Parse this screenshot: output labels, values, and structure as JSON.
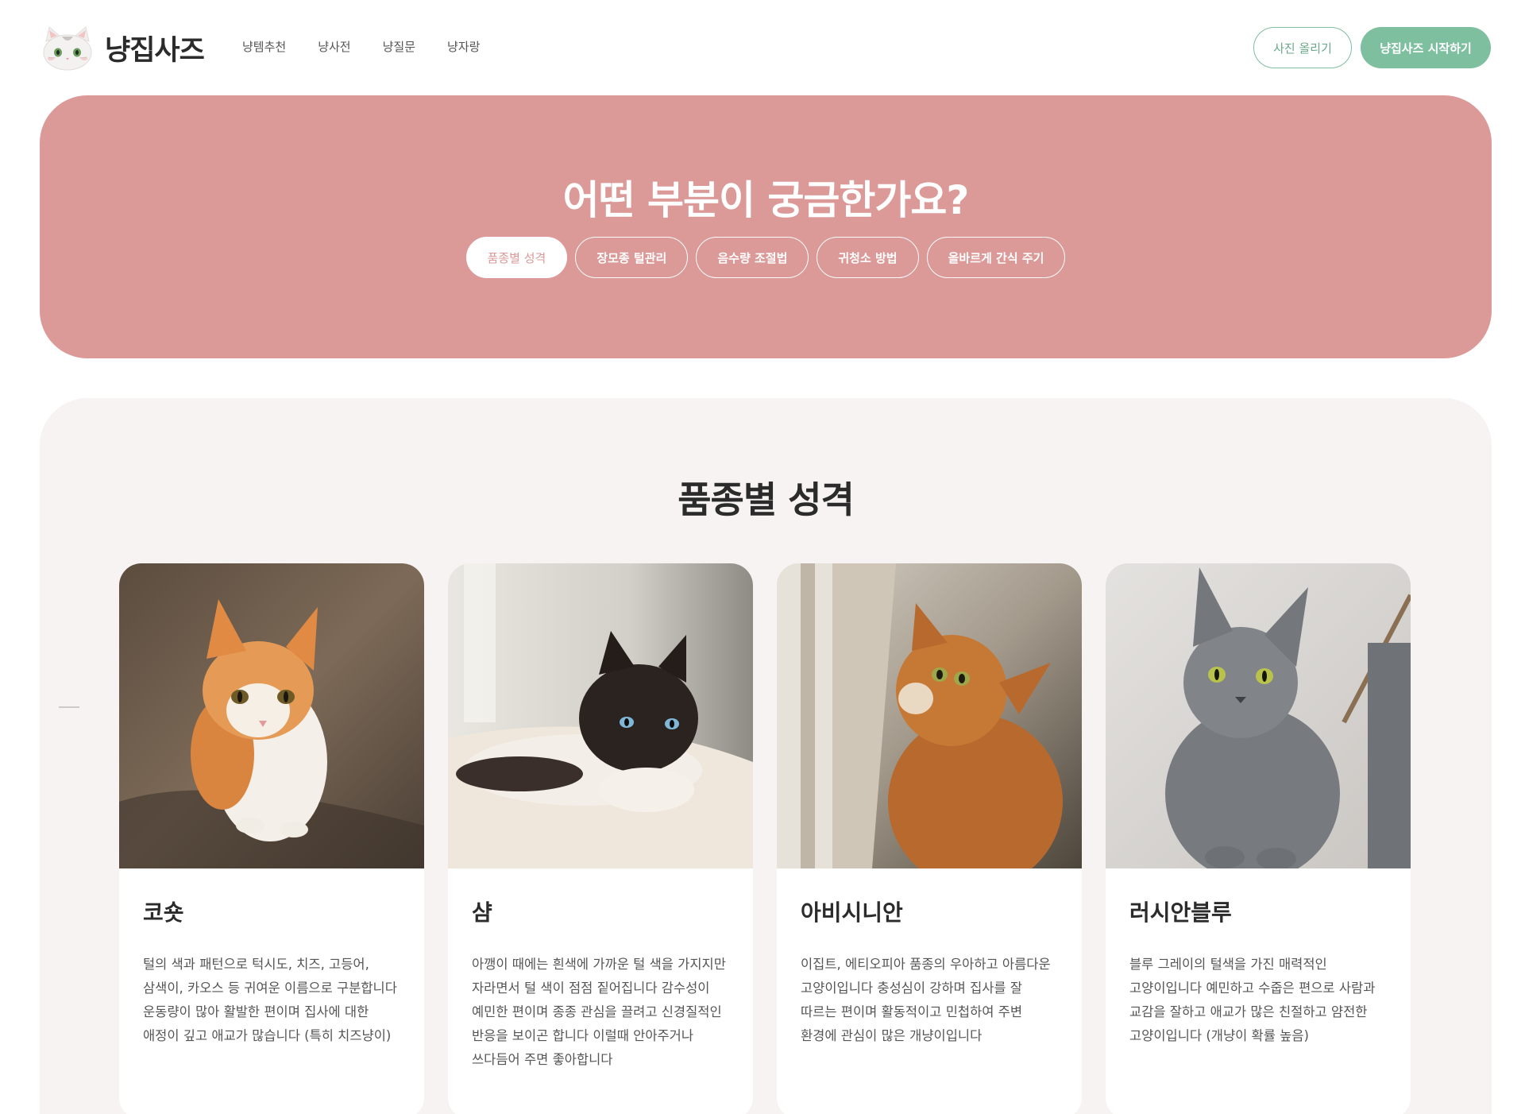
{
  "header": {
    "logo_text": "냥집사즈",
    "nav": [
      "냥템추천",
      "냥사전",
      "냥질문",
      "냥자랑"
    ],
    "upload_button": "사진 올리기",
    "start_button": "냥집사즈 시작하기"
  },
  "hero": {
    "title": "어떤 부분이 궁금한가요?",
    "tags": [
      "품종별 성격",
      "장모종 털관리",
      "음수량 조절법",
      "귀청소 방법",
      "올바르게 간식 주기"
    ],
    "active_tag": "품종별 성격"
  },
  "breeds": {
    "title": "품종별 성격",
    "cards": [
      {
        "name": "코숏",
        "description": "털의 색과 패턴으로 턱시도, 치즈, 고등어, 삼색이, 카오스 등 귀여운 이름으로 구분합니다 운동량이 많아 활발한 편이며 집사에 대한 애정이 깊고 애교가 많습니다 (특히 치즈냥이)",
        "image": "orange-white-kitten-photo"
      },
      {
        "name": "샴",
        "description": "아깽이 때에는 흰색에 가까운 털 색을 가지지만 자라면서 털 색이 점점 짙어집니다 감수성이 예민한 편이며 종종 관심을 끌려고 신경질적인 반응을 보이곤 합니다 이럴때 안아주거나 쓰다듬어 주면 좋아합니다",
        "image": "siamese-cat-on-rug-photo"
      },
      {
        "name": "아비시니안",
        "description": "이집트, 에티오피아 품종의 우아하고 아름다운 고양이입니다 충성심이 강하며 집사를 잘 따르는 편이며 활동적이고 민첩하여 주변 환경에 관심이 많은 개냥이입니다",
        "image": "abyssinian-cat-by-window-photo"
      },
      {
        "name": "러시안블루",
        "description": "블루 그레이의 털색을 가진 매력적인 고양이입니다 예민하고 수줍은 편으로 사람과 교감을 잘하고 애교가 많은 친절하고 얌전한 고양이입니다 (개냥이 확률 높음)",
        "image": "russian-blue-cat-photo"
      }
    ]
  },
  "colors": {
    "accent_green": "#7dbf9f",
    "hero_pink": "#db9998",
    "section_bg": "#f6f3f2"
  }
}
